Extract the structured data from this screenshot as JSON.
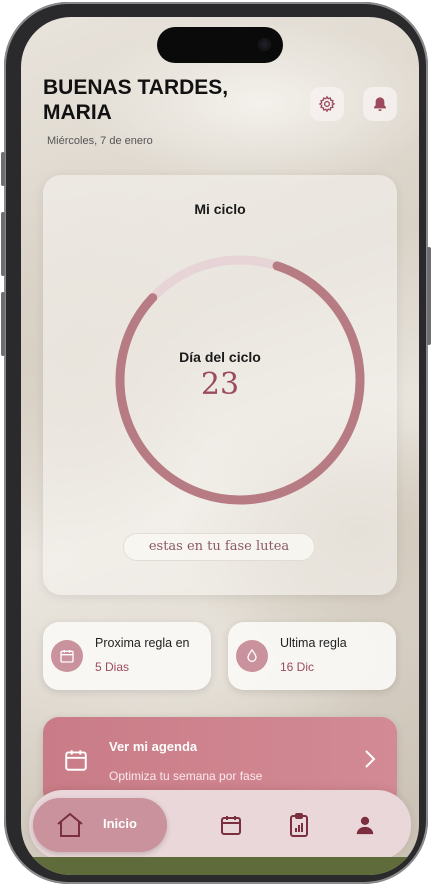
{
  "header": {
    "greeting": "BUENAS TARDES, MARIA",
    "date": "Miércoles, 7 de enero"
  },
  "icons": {
    "settings": "gear-icon",
    "notifications": "bell-icon"
  },
  "cycle": {
    "title": "Mi ciclo",
    "day_label": "Día del ciclo",
    "day_value": "23",
    "progress_fraction": 0.82,
    "phase_text": "estas en tu fase lutea"
  },
  "cards": {
    "next_period_title": "Proxima regla en",
    "next_period_value": "5 Dias",
    "last_period_title": "Ultima regla",
    "last_period_value": "16 Dic"
  },
  "agenda": {
    "title": "Ver mi agenda",
    "subtitle": "Optimiza tu semana por fase"
  },
  "nav": {
    "home_label": "Inicio"
  },
  "colors": {
    "accent": "#9c4b5c",
    "ring": "#b77b84",
    "ring_track": "#e6d4d6",
    "nav_active": "#c9929c",
    "agenda": "#cd838d"
  }
}
